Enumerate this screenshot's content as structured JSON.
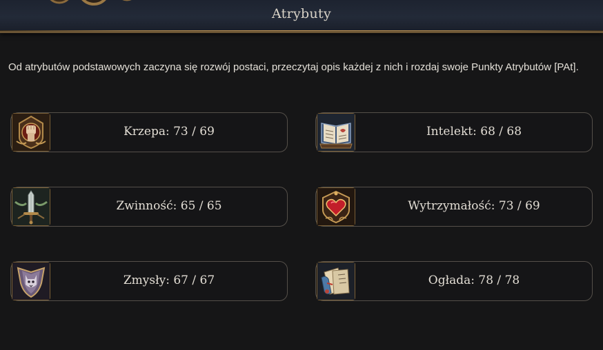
{
  "header": {
    "title": "Atrybuty"
  },
  "description": "Od atrybutów podstawowych zaczyna się rozwój postaci, przeczytaj opis każdej z nich i rozdaj swoje Punkty Atrybutów [PAt].",
  "attributes": [
    {
      "label": "Krzepa: 73 / 69",
      "icon": "fist-icon"
    },
    {
      "label": "Intelekt: 68 / 68",
      "icon": "book-icon"
    },
    {
      "label": "Zwinność: 65 / 65",
      "icon": "dagger-icon"
    },
    {
      "label": "Wytrzymałość: 73 / 69",
      "icon": "heart-icon"
    },
    {
      "label": "Zmysły: 67 / 67",
      "icon": "cat-shield-icon"
    },
    {
      "label": "Ogłada: 78 / 78",
      "icon": "scrolls-icon"
    }
  ],
  "colors": {
    "background": "#161617",
    "card_border": "#55504a",
    "icon_frame": "#7a5f36",
    "header_bar": "#232a38"
  }
}
